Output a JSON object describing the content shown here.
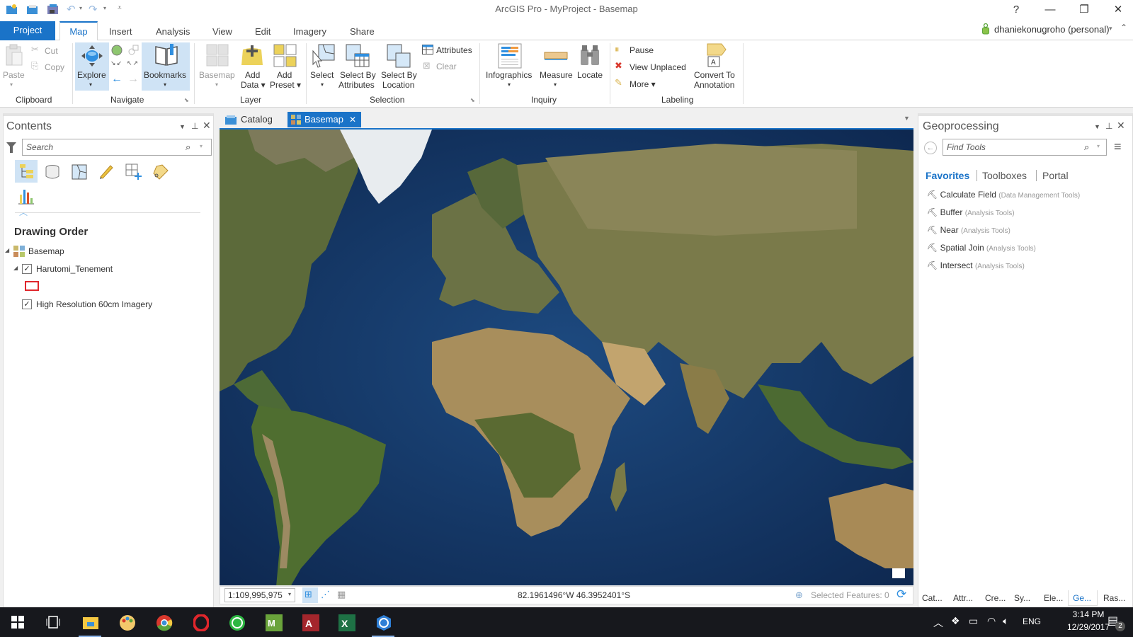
{
  "window": {
    "title": "ArcGIS Pro - MyProject - Basemap",
    "help_label": "?",
    "minimize_label": "—",
    "restore_label": "❐",
    "close_label": "✕"
  },
  "quick_access": {
    "icons": [
      "new-project-icon",
      "open-project-icon",
      "save-project-icon",
      "undo-icon",
      "redo-icon",
      "customize-icon"
    ]
  },
  "ribbon_tabs": [
    {
      "label": "Project"
    },
    {
      "label": "Map",
      "active": true
    },
    {
      "label": "Insert"
    },
    {
      "label": "Analysis"
    },
    {
      "label": "View"
    },
    {
      "label": "Edit"
    },
    {
      "label": "Imagery"
    },
    {
      "label": "Share"
    }
  ],
  "user": {
    "name": "dhaniekonugroho (personal)",
    "dropdown": "▾",
    "collapse": "⌃"
  },
  "ribbon": {
    "clipboard": {
      "paste": "Paste",
      "cut": "Cut",
      "copy": "Copy",
      "group": "Clipboard"
    },
    "navigate": {
      "explore": "Explore",
      "bookmarks": "Bookmarks",
      "group": "Navigate"
    },
    "layer": {
      "basemap": "Basemap",
      "add_data_1": "Add",
      "add_data_2": "Data ▾",
      "add_preset_1": "Add",
      "add_preset_2": "Preset ▾",
      "group": "Layer"
    },
    "selection": {
      "select": "Select",
      "select_by_attr_1": "Select By",
      "select_by_attr_2": "Attributes",
      "select_by_loc_1": "Select By",
      "select_by_loc_2": "Location",
      "attributes": "Attributes",
      "clear": "Clear",
      "group": "Selection"
    },
    "inquiry": {
      "infographics": "Infographics",
      "measure": "Measure",
      "locate": "Locate",
      "group": "Inquiry"
    },
    "labeling": {
      "pause": "Pause",
      "view_unplaced": "View Unplaced",
      "more": "More ▾",
      "convert_1": "Convert To",
      "convert_2": "Annotation",
      "group": "Labeling"
    }
  },
  "contents": {
    "title": "Contents",
    "search_placeholder": "Search",
    "section": "Drawing Order",
    "tree": [
      {
        "label": "Basemap",
        "type": "map"
      },
      {
        "label": "Harutomi_Tenement",
        "checked": true
      },
      {
        "label": "High Resolution 60cm Imagery",
        "checked": true
      }
    ],
    "check": "✓"
  },
  "view_tabs": [
    {
      "label": "Catalog"
    },
    {
      "label": "Basemap",
      "active": true,
      "close": "✕"
    }
  ],
  "statusbar": {
    "scale": "1:109,995,975",
    "coordinates": "82.1961496°W 46.3952401°S",
    "selected_features": "Selected Features: 0"
  },
  "geoprocessing": {
    "title": "Geoprocessing",
    "search_placeholder": "Find Tools",
    "tabs": [
      {
        "label": "Favorites",
        "active": true
      },
      {
        "label": "Toolboxes"
      },
      {
        "label": "Portal"
      }
    ],
    "tools": [
      {
        "name": "Calculate Field",
        "category": "(Data Management Tools)"
      },
      {
        "name": "Buffer",
        "category": "(Analysis Tools)"
      },
      {
        "name": "Near",
        "category": "(Analysis Tools)"
      },
      {
        "name": "Spatial Join",
        "category": "(Analysis Tools)"
      },
      {
        "name": "Intersect",
        "category": "(Analysis Tools)"
      }
    ],
    "bottom_tabs": [
      {
        "label": "Cat..."
      },
      {
        "label": "Attr..."
      },
      {
        "label": "Cre..."
      },
      {
        "label": "Sy..."
      },
      {
        "label": "Ele..."
      },
      {
        "label": "Ge...",
        "active": true
      },
      {
        "label": "Ras..."
      }
    ]
  },
  "taskbar": {
    "apps": [
      "start-icon",
      "task-view-icon",
      "file-explorer-icon",
      "paint-icon",
      "chrome-icon",
      "opera-icon",
      "whatsapp-icon",
      "mendeley-icon",
      "access-icon",
      "excel-icon",
      "arcgis-pro-icon"
    ],
    "language": "ENG",
    "time": "3:14 PM",
    "date": "12/29/2017",
    "notifications": "2"
  },
  "colors": {
    "accent": "#1a73c8",
    "map_ocean": "#163a6b"
  }
}
